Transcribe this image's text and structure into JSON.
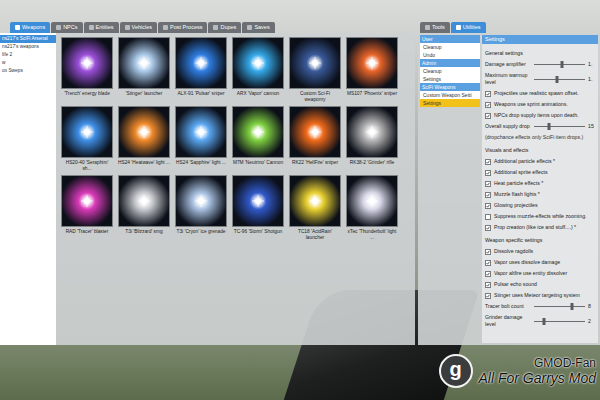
{
  "spawnmenu": {
    "tabs": [
      {
        "label": "Weapons",
        "selected": true
      },
      {
        "label": "NPCs",
        "selected": false
      },
      {
        "label": "Entities",
        "selected": false
      },
      {
        "label": "Vehicles",
        "selected": false
      },
      {
        "label": "Post Process",
        "selected": false
      },
      {
        "label": "Dupes",
        "selected": false
      },
      {
        "label": "Saves",
        "selected": false
      }
    ],
    "sidebar": {
      "items": [
        {
          "label": "ns217's SciFi Arsenal",
          "selected": true
        },
        {
          "label": "ns217's weapons",
          "selected": false
        },
        {
          "label": "life 2",
          "selected": false
        },
        {
          "label": "w",
          "selected": false
        },
        {
          "label": "ox Sweps",
          "selected": false
        }
      ]
    },
    "weapons": [
      {
        "label": "'Trench' energy blade",
        "color": "#9b4fd8"
      },
      {
        "label": "'Stinger' launcher",
        "color": "#a9c8e8"
      },
      {
        "label": "ALX-91 'Pulsar' sniper",
        "color": "#2f7de0"
      },
      {
        "label": "ARX 'Vapor' cannon",
        "color": "#35a8e8"
      },
      {
        "label": "Custom Sci-Fi weaponry",
        "color": "#3a5a9a"
      },
      {
        "label": "MS107 'Phoenix' sniper",
        "color": "#e8642a"
      },
      {
        "label": "HS20-40 'Seraphim' sh...",
        "color": "#3f8fe6"
      },
      {
        "label": "HS24 'Heatwave' light ...",
        "color": "#f08a2a"
      },
      {
        "label": "HS24 'Sapphire' light ...",
        "color": "#5aa6f0"
      },
      {
        "label": "M7M 'Neutrino' Cannon",
        "color": "#7fd040"
      },
      {
        "label": "RK22 'HellFire' sniper",
        "color": "#f06a1a"
      },
      {
        "label": "RK38-2 'Grinder' rifle",
        "color": "#b8b8b8"
      },
      {
        "label": "RAD 'Tracer' blaster",
        "color": "#d83ab8"
      },
      {
        "label": "T3i 'Blizzard' smg",
        "color": "#c8ccd0"
      },
      {
        "label": "T3i 'Cryon' ice grenade",
        "color": "#a8c0e0"
      },
      {
        "label": "TC-96 'Storm' Shotgun",
        "color": "#3058c8"
      },
      {
        "label": "TC18 'AcidRain' launcher",
        "color": "#e8d030"
      },
      {
        "label": "xTec 'Thunderbolt' light ...",
        "color": "#d8d8e8"
      }
    ]
  },
  "toolmenu": {
    "tabs": [
      {
        "label": "Tools",
        "selected": false
      },
      {
        "label": "Utilities",
        "selected": true
      }
    ],
    "tree": [
      {
        "header": "User",
        "items": [
          {
            "label": "Cleanup",
            "selected": false
          },
          {
            "label": "Undo",
            "selected": false
          }
        ]
      },
      {
        "header": "Admin",
        "items": [
          {
            "label": "Cleanup",
            "selected": false
          },
          {
            "label": "Settings",
            "selected": false
          }
        ]
      },
      {
        "header": "SciFi Weapons",
        "items": [
          {
            "label": "Custom Weapon Setti",
            "selected": false
          },
          {
            "label": "Settings",
            "selected": true
          }
        ]
      }
    ],
    "settings": {
      "title": "Settings",
      "rows": [
        {
          "kind": "heading",
          "label": "General settings"
        },
        {
          "kind": "slider",
          "label": "Damage amplifier",
          "level": 0.55,
          "value": "1."
        },
        {
          "kind": "slider",
          "label": "Maximum warmup level",
          "level": 0.45,
          "value": "1."
        },
        {
          "kind": "checkbox",
          "label": "Projectiles use realistic spawn offset.",
          "checked": true
        },
        {
          "kind": "checkbox",
          "label": "Weapons use sprint animations.",
          "checked": true
        },
        {
          "kind": "checkbox",
          "label": "NPCs drop supply items upon death.",
          "checked": true
        },
        {
          "kind": "slider",
          "label": "Overall supply drop",
          "level": 0.3,
          "value": "15"
        },
        {
          "kind": "note",
          "label": "(dropchance effects only SciFi item drops.)"
        },
        {
          "kind": "heading",
          "label": "Visuals and effects"
        },
        {
          "kind": "checkbox",
          "label": "Additional particle effects *",
          "checked": true
        },
        {
          "kind": "checkbox",
          "label": "Additional sprite effects",
          "checked": true
        },
        {
          "kind": "checkbox",
          "label": "Heat particle effects *",
          "checked": true
        },
        {
          "kind": "checkbox",
          "label": "Muzzle flash lights *",
          "checked": true
        },
        {
          "kind": "checkbox",
          "label": "Glowing projectiles",
          "checked": true
        },
        {
          "kind": "checkbox",
          "label": "Suppress muzzle-effects while zooming.",
          "checked": false
        },
        {
          "kind": "checkbox",
          "label": "Prop creation (like ice and stuff....) *",
          "checked": true
        },
        {
          "kind": "heading",
          "label": "Weapon specific settings"
        },
        {
          "kind": "checkbox",
          "label": "Dissolve ragdolls",
          "checked": true
        },
        {
          "kind": "checkbox",
          "label": "Vapor uses dissolve damage",
          "checked": true
        },
        {
          "kind": "checkbox",
          "label": "Vapor altfire use entity dissolver",
          "checked": true
        },
        {
          "kind": "checkbox",
          "label": "Pulsar echo sound",
          "checked": true
        },
        {
          "kind": "checkbox",
          "label": "Stinger uses Meteor targeting system",
          "checked": true
        },
        {
          "kind": "slider",
          "label": "Tracer bolt count",
          "level": 0.75,
          "value": "8"
        },
        {
          "kind": "slider",
          "label": "Grinder damage level",
          "level": 0.2,
          "value": "2"
        }
      ]
    }
  },
  "watermark": {
    "logo": "g",
    "name": "GMOD-Fan",
    "slogan": "All For Garrys Mod"
  }
}
